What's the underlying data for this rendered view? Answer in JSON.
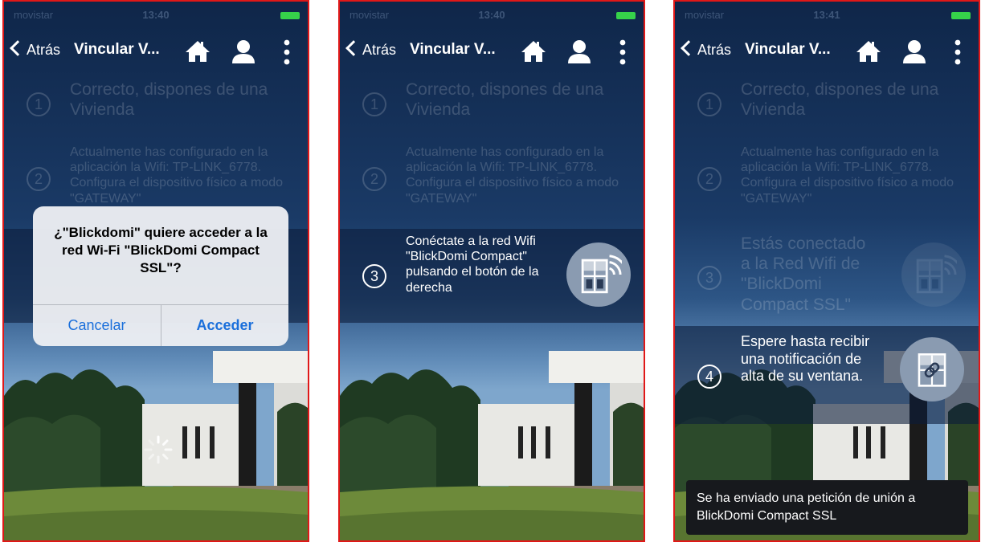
{
  "screens": [
    {
      "status": {
        "carrier": "movistar",
        "time": "13:40"
      },
      "nav": {
        "back": "Atrás",
        "title": "Vincular V..."
      },
      "step1": {
        "num": "1",
        "text": "Correcto, dispones de una Vivienda"
      },
      "step2": {
        "num": "2",
        "text": "Actualmente has configurado en la aplicación la Wifi: TP-LINK_6778. Configura el dispositivo físico a modo \"GATEWAY\""
      },
      "dialog": {
        "message": "¿\"Blickdomi\" quiere acceder a la red Wi-Fi \"BlickDomi Compact SSL\"?",
        "cancel": "Cancelar",
        "accept": "Acceder"
      }
    },
    {
      "status": {
        "carrier": "movistar",
        "time": "13:40"
      },
      "nav": {
        "back": "Atrás",
        "title": "Vincular V..."
      },
      "step1": {
        "num": "1",
        "text": "Correcto, dispones de una Vivienda"
      },
      "step2": {
        "num": "2",
        "text": "Actualmente has configurado en la aplicación la Wifi: TP-LINK_6778. Configura el dispositivo físico a modo \"GATEWAY\""
      },
      "step3": {
        "num": "3",
        "text": "Conéctate a la red Wifi \"BlickDomi Compact\" pulsando el botón de la derecha"
      }
    },
    {
      "status": {
        "carrier": "movistar",
        "time": "13:41"
      },
      "nav": {
        "back": "Atrás",
        "title": "Vincular V..."
      },
      "step1": {
        "num": "1",
        "text": "Correcto, dispones de una Vivienda"
      },
      "step2": {
        "num": "2",
        "text": "Actualmente has configurado en la aplicación la Wifi: TP-LINK_6778. Configura el dispositivo físico a modo \"GATEWAY\""
      },
      "step3": {
        "num": "3",
        "text": "Estás conectado a la Red Wifi de \"BlickDomi Compact SSL\""
      },
      "step4": {
        "num": "4",
        "text": "Espere hasta recibir una notificación de alta de su ventana."
      },
      "toast": "Se ha enviado una petición de unión a BlickDomi Compact SSL"
    }
  ],
  "colors": {
    "frame": "#e01818",
    "accent": "#1a6fdb",
    "battery": "#36d24a"
  },
  "icons": [
    "back-chevron-icon",
    "home-icon",
    "user-icon",
    "more-vertical-icon",
    "window-wifi-icon",
    "window-link-icon",
    "spinner-icon"
  ]
}
